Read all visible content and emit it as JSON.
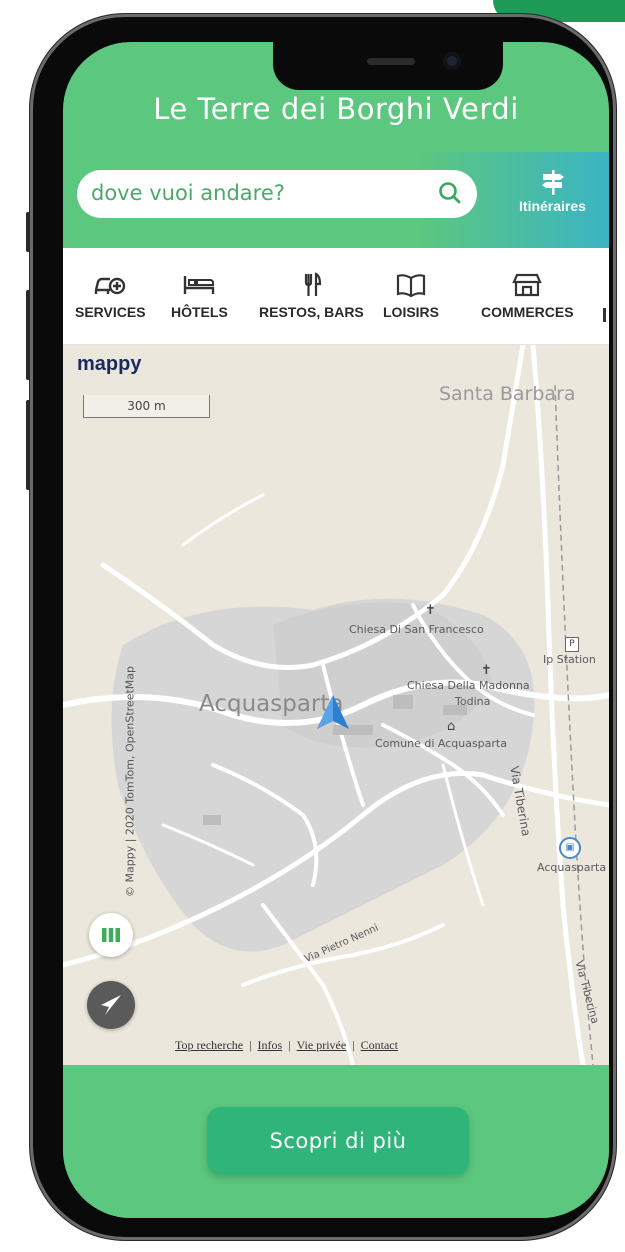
{
  "app": {
    "title": "Le Terre dei Borghi Verdi"
  },
  "search": {
    "placeholder": "dove vuoi andare?",
    "itineraries_label": "Itinéraires"
  },
  "categories": [
    {
      "label": "SERVICES",
      "icon": "car-plus-icon"
    },
    {
      "label": "HÔTELS",
      "icon": "bed-icon"
    },
    {
      "label": "RESTOS, BARS",
      "icon": "fork-knife-icon"
    },
    {
      "label": "LOISIRS",
      "icon": "book-icon"
    },
    {
      "label": "COMMERCES",
      "icon": "shop-icon"
    }
  ],
  "map": {
    "provider_logo": "mappy",
    "scale_label": "300 m",
    "copyright": "© Mappy | 2020 TomTom, OpenStreetMap",
    "labels": {
      "santa_barbara": "Santa Barbara",
      "acquasparta": "Acquasparta",
      "chiesa_san_francesco": "Chiesa Di San Francesco",
      "ip_station": "Ip Station",
      "chiesa_madonna": "Chiesa Della Madonna",
      "todina": "Todina",
      "comune": "Comune di Acquasparta",
      "via_tiberina_1": "Via Tiberina",
      "via_tiberina_2": "Via Tiberina",
      "acquasparta_station": "Acquasparta",
      "via_pietro_nenni": "Via Pietro Nenni"
    },
    "footer_links": [
      "Top recherche",
      "Infos",
      "Vie privée",
      "Contact"
    ]
  },
  "cta": {
    "label": "Scopri di più"
  },
  "colors": {
    "primary_green": "#5cc77e",
    "cta_green": "#2fb57a",
    "accent_teal": "#3bb4c4",
    "map_bg": "#ece7dd"
  }
}
